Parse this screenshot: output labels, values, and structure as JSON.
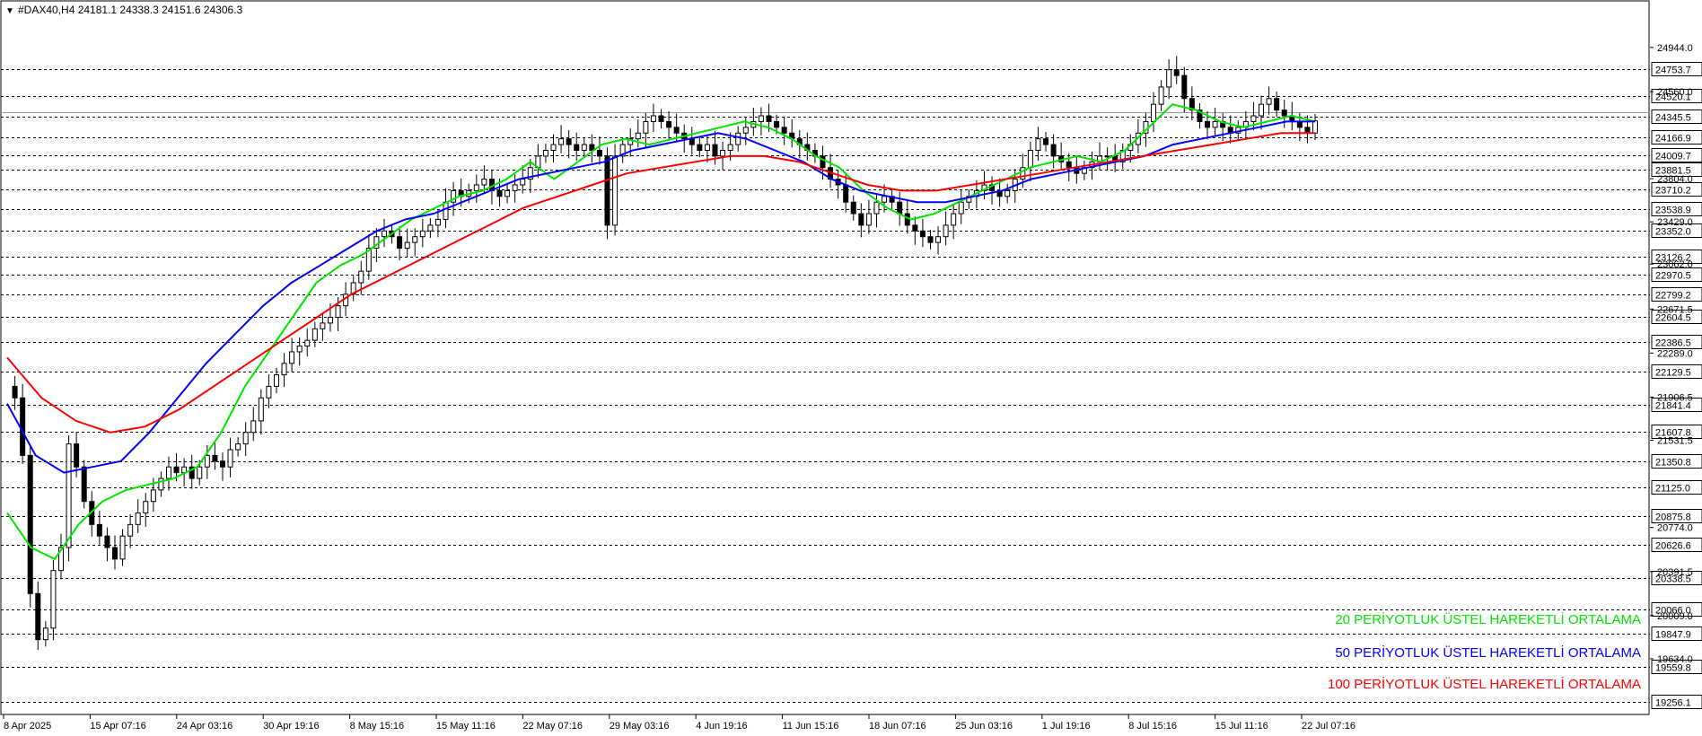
{
  "header": {
    "symbol_line": "#DAX40,H4  24181.1 24338.3 24151.6 24306.3"
  },
  "colors": {
    "ema20": "#00e600",
    "ema50": "#0000ff",
    "ema100": "#ff0000",
    "candle": "#000000",
    "grid": "#000000",
    "background": "#ffffff"
  },
  "legend": [
    {
      "label": "20 PERİYOTLUK ÜSTEL HAREKETLİ ORTALAMA",
      "color": "#00e600"
    },
    {
      "label": "50 PERİYOTLUK ÜSTEL HAREKETLİ ORTALAMA",
      "color": "#0000ff"
    },
    {
      "label": "100 PERİYOTLUK ÜSTEL HAREKETLİ ORTALAMA",
      "color": "#ff0000"
    }
  ],
  "chart_data": {
    "type": "line",
    "title": "#DAX40,H4",
    "xlabel": "",
    "ylabel": "",
    "ylim": [
      19150,
      25200
    ],
    "x_ticks": [
      "8 Apr 2025",
      "15 Apr 07:16",
      "24 Apr 03:16",
      "30 Apr 19:16",
      "8 May 15:16",
      "15 May 11:16",
      "22 May 07:16",
      "29 May 03:16",
      "4 Jun 19:16",
      "11 Jun 15:16",
      "18 Jun 07:16",
      "25 Jun 03:16",
      "1 Jul 19:16",
      "8 Jul 15:16",
      "15 Jul 11:16",
      "22 Jul 07:16"
    ],
    "level_lines": [
      24753.7,
      24520.1,
      24345.5,
      24166.9,
      24009.7,
      23881.5,
      23710.2,
      23538.9,
      23352.0,
      23126.2,
      22970.5,
      22799.2,
      22604.5,
      22386.5,
      22129.5,
      21841.4,
      21607.8,
      21350.8,
      21125.0,
      20875.8,
      20626.6,
      20338.5,
      20066.0,
      19847.9,
      19559.8,
      19256.1
    ],
    "axis_ticks": [
      24944.0,
      24560.0,
      23804.0,
      23429.0,
      23062.0,
      22671.5,
      22289.0,
      21906.5,
      21531.5,
      20774.0,
      20391.5,
      20009.0,
      19634.0
    ],
    "current_price": 24306.3,
    "price_line": 24345.5,
    "ohlc_last": {
      "open": 24181.1,
      "high": 24338.3,
      "low": 24151.6,
      "close": 24306.3
    },
    "grid": false,
    "legend_position": "bottom-right",
    "close_series": [
      22000,
      21900,
      21400,
      20200,
      19800,
      19900,
      20400,
      20600,
      21500,
      21300,
      21000,
      20800,
      20700,
      20600,
      20500,
      20700,
      20800,
      20900,
      21000,
      21100,
      21200,
      21300,
      21250,
      21300,
      21200,
      21300,
      21400,
      21350,
      21300,
      21450,
      21500,
      21600,
      21700,
      21900,
      22000,
      22100,
      22200,
      22300,
      22350,
      22400,
      22500,
      22550,
      22600,
      22700,
      22800,
      22900,
      23000,
      23200,
      23300,
      23350,
      23300,
      23200,
      23250,
      23300,
      23350,
      23400,
      23450,
      23600,
      23700,
      23650,
      23700,
      23750,
      23800,
      23700,
      23650,
      23700,
      23750,
      23800,
      23900,
      24000,
      24050,
      24100,
      24150,
      24100,
      24050,
      24100,
      24050,
      24000,
      23400,
      24000,
      24100,
      24150,
      24200,
      24300,
      24350,
      24300,
      24250,
      24200,
      24150,
      24100,
      24050,
      24100,
      24000,
      24050,
      24100,
      24200,
      24250,
      24300,
      24350,
      24300,
      24250,
      24200,
      24150,
      24100,
      24050,
      24000,
      23900,
      23800,
      23750,
      23600,
      23500,
      23400,
      23500,
      23600,
      23650,
      23600,
      23500,
      23400,
      23350,
      23300,
      23250,
      23300,
      23400,
      23500,
      23600,
      23650,
      23700,
      23750,
      23700,
      23650,
      23700,
      23800,
      23900,
      24050,
      24150,
      24100,
      24000,
      23950,
      23900,
      23850,
      23900,
      23950,
      24000,
      24000,
      23950,
      24050,
      24100,
      24200,
      24300,
      24450,
      24600,
      24750,
      24700,
      24500,
      24400,
      24300,
      24250,
      24300,
      24250,
      24200,
      24250,
      24300,
      24350,
      24450,
      24500,
      24400,
      24350,
      24300,
      24250,
      24200,
      24306
    ],
    "series": [
      {
        "name": "20 PERİYOTLUK ÜSTEL HAREKETLİ ORTALAMA",
        "values": [
          20900,
          20600,
          20500,
          20800,
          21000,
          21100,
          21150,
          21200,
          21300,
          21600,
          22000,
          22300,
          22600,
          22900,
          23050,
          23150,
          23300,
          23450,
          23550,
          23650,
          23700,
          23800,
          23950,
          23800,
          23950,
          24100,
          24150,
          24100,
          24150,
          24200,
          24250,
          24300,
          24250,
          24150,
          24000,
          23900,
          23700,
          23550,
          23450,
          23500,
          23600,
          23700,
          23800,
          23900,
          23950,
          24000,
          23950,
          24050,
          24250,
          24450,
          24400,
          24300,
          24250,
          24300,
          24350,
          24300
        ]
      },
      {
        "name": "50 PERİYOTLUK ÜSTEL HAREKETLİ ORTALAMA",
        "values": [
          21850,
          21400,
          21250,
          21300,
          21350,
          21600,
          21900,
          22200,
          22450,
          22700,
          22900,
          23050,
          23200,
          23350,
          23450,
          23500,
          23600,
          23700,
          23800,
          23850,
          23900,
          23950,
          24050,
          24100,
          24150,
          24200,
          24150,
          24050,
          23950,
          23800,
          23700,
          23650,
          23600,
          23600,
          23650,
          23700,
          23800,
          23850,
          23900,
          23950,
          24000,
          24100,
          24150,
          24200,
          24250,
          24300,
          24300
        ]
      },
      {
        "name": "100 PERİYOTLUK ÜSTEL HAREKETLİ ORTALAMA",
        "values": [
          22250,
          21900,
          21700,
          21600,
          21650,
          21800,
          22000,
          22200,
          22400,
          22600,
          22800,
          22950,
          23100,
          23250,
          23400,
          23550,
          23650,
          23750,
          23850,
          23900,
          23950,
          24000,
          24000,
          23950,
          23850,
          23750,
          23700,
          23700,
          23750,
          23800,
          23850,
          23900,
          23950,
          24000,
          24050,
          24100,
          24150,
          24200,
          24200
        ]
      }
    ]
  }
}
